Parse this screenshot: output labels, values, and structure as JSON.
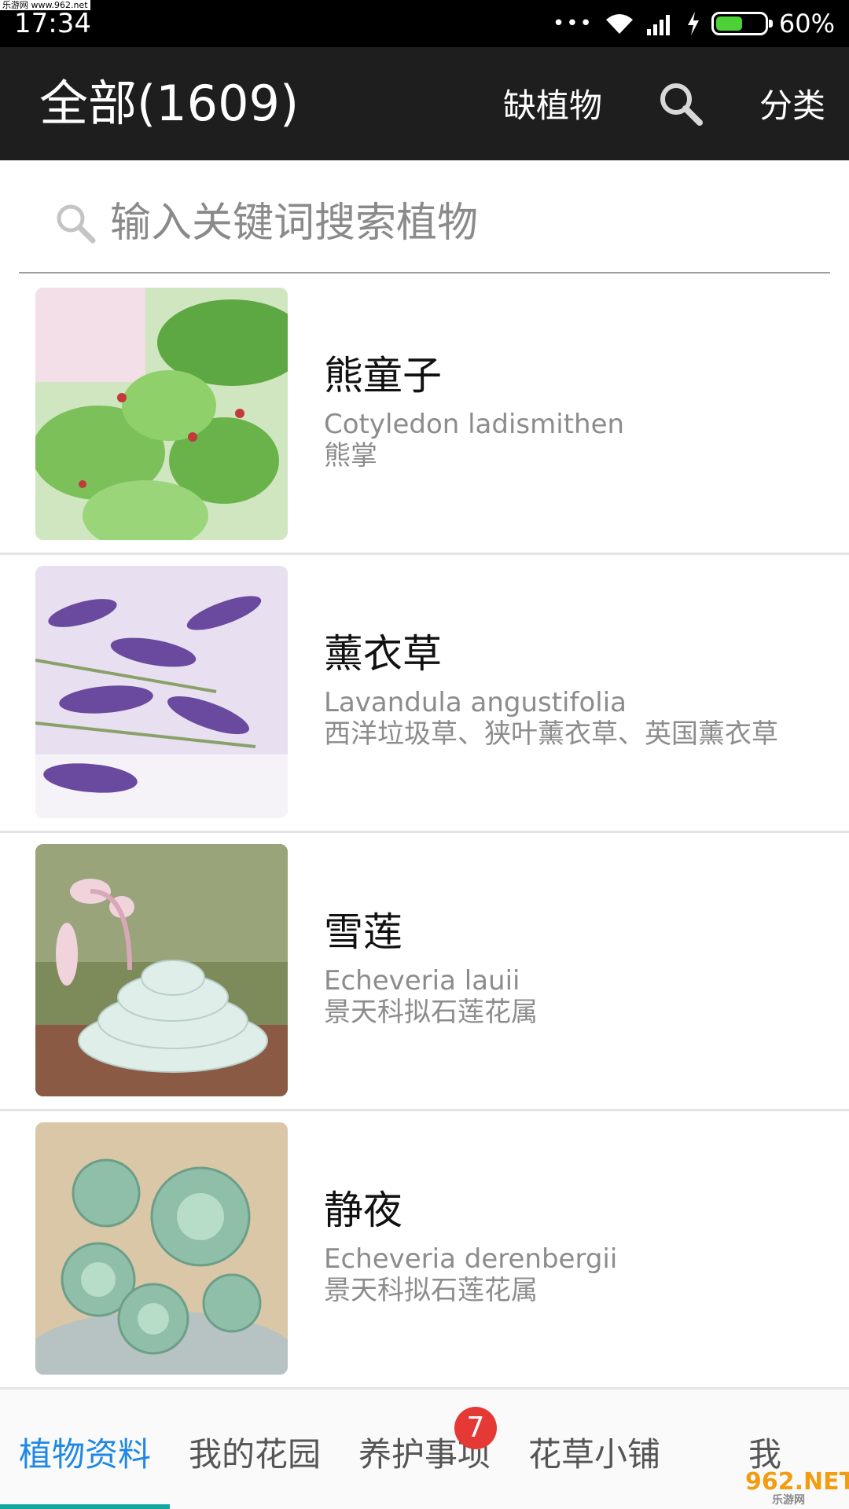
{
  "status_bar": {
    "watermark": "乐游网 www.962.net",
    "time": "17:34",
    "dots": "•••",
    "battery_level": 0.6,
    "battery_text": "60%",
    "battery_color": "#4cd137"
  },
  "app_bar": {
    "title": "全部(1609)",
    "missing_label": "缺植物",
    "search_icon": "search-icon",
    "category_label": "分类",
    "background": "#1e1e1e"
  },
  "search": {
    "placeholder": "输入关键词搜索植物",
    "value": ""
  },
  "plants": [
    {
      "name": "熊童子",
      "latin": "Cotyledon ladismithen",
      "alias": "熊掌",
      "image": "fuzzy green succulent"
    },
    {
      "name": "薰衣草",
      "latin": "Lavandula angustifolia",
      "alias": "西洋垃圾草、狭叶薰衣草、英国薰衣草",
      "image": "purple lavender flowers"
    },
    {
      "name": "雪莲",
      "latin": "Echeveria lauii",
      "alias": "景天科拟石莲花属",
      "image": "pale rosette succulent"
    },
    {
      "name": "静夜",
      "latin": "Echeveria derenbergii",
      "alias": "景天科拟石莲花属",
      "image": "small green rosettes in pot"
    }
  ],
  "bottom_nav": {
    "tabs": [
      "植物资料",
      "我的花园",
      "养护事项",
      "花草小铺",
      "我"
    ],
    "active_index": 0,
    "badge": "7",
    "accent": "#1e88e5",
    "indicator_color": "#13a89e"
  },
  "corner_logo": {
    "big": "962.NET",
    "small": "乐游网"
  }
}
